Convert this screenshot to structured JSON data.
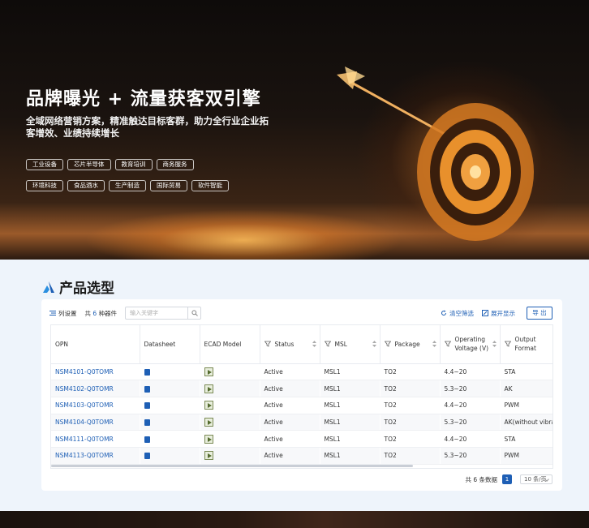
{
  "hero": {
    "title": "品牌曝光 + 流量获客双引擎",
    "subtitle": "全域网络营销方案，精准触达目标客群，助力全行业企业拓客增效、业绩持续增长",
    "tags_row1": [
      "工业设备",
      "芯片半导体",
      "教育培训",
      "商务服务"
    ],
    "tags_row2": [
      "环境科技",
      "食品酒水",
      "生产制造",
      "国际贸易",
      "软件智能"
    ]
  },
  "section": {
    "title": "产品选型"
  },
  "toolbar": {
    "column_settings": "列设置",
    "count_prefix": "共",
    "count_value": "6",
    "count_suffix": "种器件",
    "search_placeholder": "输入关键字",
    "clear_filter": "清空筛选",
    "expand_display": "展开显示",
    "export": "导 出"
  },
  "table": {
    "headers": {
      "opn": "OPN",
      "datasheet": "Datasheet",
      "ecad": "ECAD Model",
      "status": "Status",
      "msl": "MSL",
      "package": "Package",
      "voltage": "Operating Voltage (V)",
      "output": "Output Format"
    },
    "rows": [
      {
        "opn": "NSM4101-Q0TOMR",
        "status": "Active",
        "msl": "MSL1",
        "package": "TO2",
        "voltage": "4.4~20",
        "output": "STA"
      },
      {
        "opn": "NSM4102-Q0TOMR",
        "status": "Active",
        "msl": "MSL1",
        "package": "TO2",
        "voltage": "5.3~20",
        "output": "AK"
      },
      {
        "opn": "NSM4103-Q0TOMR",
        "status": "Active",
        "msl": "MSL1",
        "package": "TO2",
        "voltage": "4.4~20",
        "output": "PWM"
      },
      {
        "opn": "NSM4104-Q0TOMR",
        "status": "Active",
        "msl": "MSL1",
        "package": "TO2",
        "voltage": "5.3~20",
        "output": "AK(without vibrati"
      },
      {
        "opn": "NSM4111-Q0TOMR",
        "status": "Active",
        "msl": "MSL1",
        "package": "TO2",
        "voltage": "4.4~20",
        "output": "STA"
      },
      {
        "opn": "NSM4113-Q0TOMR",
        "status": "Active",
        "msl": "MSL1",
        "package": "TO2",
        "voltage": "5.3~20",
        "output": "PWM"
      }
    ]
  },
  "pager": {
    "total_text": "共 6 条数据",
    "current_page": "1",
    "page_size": "10 条/页"
  },
  "colors": {
    "accent": "#1e5fb5"
  },
  "icons": [
    "column-settings-icon",
    "search-icon",
    "refresh-icon",
    "expand-icon",
    "filter-icon",
    "sort-icon",
    "datasheet-icon",
    "ecad-model-icon",
    "section-logo-icon",
    "target-illustration"
  ]
}
